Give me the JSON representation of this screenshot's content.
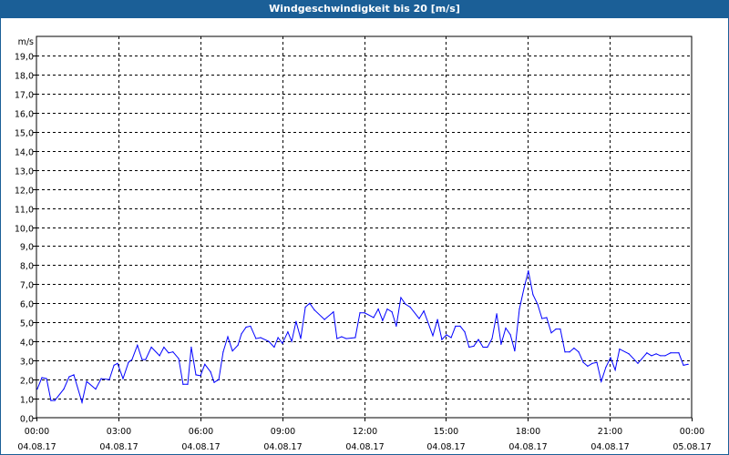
{
  "window": {
    "title": "Windgeschwindigkeit bis 20 [m/s]"
  },
  "chart_data": {
    "type": "line",
    "title": "Windgeschwindigkeit bis 20 [m/s]",
    "ylabel": "m/s",
    "xlabel": "",
    "ylim": [
      0,
      20
    ],
    "xlim_hours": [
      0,
      24
    ],
    "grid": true,
    "y_ticks": [
      "0,0",
      "1,0",
      "2,0",
      "3,0",
      "4,0",
      "5,0",
      "6,0",
      "7,0",
      "8,0",
      "9,0",
      "10,0",
      "11,0",
      "12,0",
      "13,0",
      "14,0",
      "15,0",
      "16,0",
      "17,0",
      "18,0",
      "19,0"
    ],
    "x_ticks": [
      {
        "time": "00:00",
        "date": "04.08.17"
      },
      {
        "time": "03:00",
        "date": "04.08.17"
      },
      {
        "time": "06:00",
        "date": "04.08.17"
      },
      {
        "time": "09:00",
        "date": "04.08.17"
      },
      {
        "time": "12:00",
        "date": "04.08.17"
      },
      {
        "time": "15:00",
        "date": "04.08.17"
      },
      {
        "time": "18:00",
        "date": "04.08.17"
      },
      {
        "time": "21:00",
        "date": "04.08.17"
      },
      {
        "time": "00:00",
        "date": "05.08.17"
      }
    ],
    "series": [
      {
        "name": "Windgeschwindigkeit",
        "color": "#0000ff",
        "x": [
          0.03,
          0.2,
          0.37,
          0.53,
          0.67,
          1.0,
          1.2,
          1.37,
          1.67,
          1.84,
          2.17,
          2.37,
          2.67,
          2.84,
          2.97,
          3.17,
          3.37,
          3.5,
          3.7,
          3.87,
          4.0,
          4.21,
          4.51,
          4.67,
          4.84,
          5.0,
          5.21,
          5.37,
          5.54,
          5.67,
          5.84,
          6.01,
          6.17,
          6.38,
          6.51,
          6.68,
          6.84,
          7.01,
          7.18,
          7.38,
          7.51,
          7.68,
          7.84,
          8.04,
          8.21,
          8.51,
          8.71,
          8.85,
          9.01,
          9.21,
          9.35,
          9.51,
          9.68,
          9.85,
          10.01,
          10.18,
          10.55,
          10.88,
          11.01,
          11.18,
          11.35,
          11.68,
          11.85,
          12.02,
          12.35,
          12.52,
          12.68,
          12.85,
          13.02,
          13.18,
          13.35,
          13.52,
          13.69,
          14.02,
          14.19,
          14.52,
          14.69,
          14.85,
          15.02,
          15.19,
          15.35,
          15.52,
          15.69,
          15.85,
          16.02,
          16.19,
          16.36,
          16.52,
          16.69,
          16.86,
          17.02,
          17.19,
          17.36,
          17.52,
          17.69,
          17.86,
          18.02,
          18.19,
          18.36,
          18.52,
          18.69,
          18.86,
          19.03,
          19.19,
          19.36,
          19.53,
          19.69,
          19.86,
          20.03,
          20.19,
          20.36,
          20.53,
          20.69,
          20.86,
          21.03,
          21.2,
          21.36,
          21.7,
          22.03,
          22.36,
          22.53,
          22.7,
          22.86,
          23.03,
          23.23,
          23.53,
          23.7,
          23.87
        ],
        "y": [
          1.5,
          2.1,
          2.05,
          0.9,
          0.9,
          1.5,
          2.15,
          2.25,
          0.8,
          1.9,
          1.5,
          2.05,
          2.0,
          2.75,
          2.85,
          2.05,
          2.9,
          3.05,
          3.8,
          3.05,
          3.05,
          3.7,
          3.25,
          3.7,
          3.4,
          3.45,
          3.1,
          1.75,
          1.75,
          3.7,
          2.25,
          2.2,
          2.8,
          2.4,
          1.85,
          2.0,
          3.45,
          4.25,
          3.5,
          3.8,
          4.4,
          4.75,
          4.8,
          4.15,
          4.2,
          4.0,
          3.7,
          4.2,
          3.9,
          4.5,
          4.0,
          5.05,
          4.15,
          5.8,
          6.0,
          5.65,
          5.15,
          5.55,
          4.15,
          4.25,
          4.15,
          4.2,
          5.5,
          5.5,
          5.25,
          5.7,
          5.1,
          5.7,
          5.55,
          4.8,
          6.3,
          5.95,
          5.8,
          5.2,
          5.6,
          4.3,
          5.15,
          4.1,
          4.35,
          4.2,
          4.8,
          4.8,
          4.5,
          3.7,
          3.75,
          4.1,
          3.7,
          3.7,
          4.15,
          5.45,
          3.85,
          4.7,
          4.35,
          3.5,
          5.7,
          6.8,
          7.7,
          6.45,
          5.95,
          5.2,
          5.25,
          4.45,
          4.65,
          4.65,
          3.45,
          3.45,
          3.65,
          3.45,
          2.9,
          2.7,
          2.85,
          2.9,
          1.9,
          2.65,
          3.15,
          2.5,
          3.6,
          3.35,
          2.85,
          3.4,
          3.25,
          3.35,
          3.25,
          3.25,
          3.4,
          3.4,
          2.75,
          2.8
        ]
      }
    ]
  }
}
